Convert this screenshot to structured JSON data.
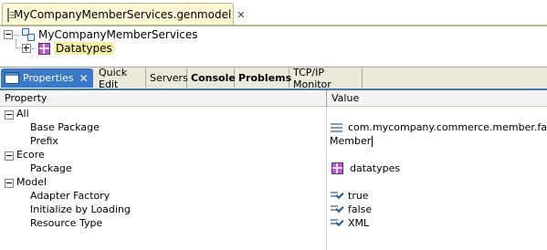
{
  "editor": {
    "tab_title": "MyCompanyMemberServices.genmodel",
    "tree": [
      {
        "label": "MyCompanyMemberServices"
      },
      {
        "label": "Datatypes"
      }
    ]
  },
  "view": {
    "tabs": [
      {
        "label": "Properties"
      },
      {
        "label": "Quick Edit"
      },
      {
        "label": "Servers"
      },
      {
        "label": "Console"
      },
      {
        "label": "Problems"
      },
      {
        "label": "TCP/IP Monitor"
      }
    ],
    "columns": {
      "property": "Property",
      "value": "Value"
    }
  },
  "properties": {
    "all": {
      "label": "All",
      "base_package": {
        "name": "Base Package",
        "value": "com.mycompany.commerce.member.facade"
      },
      "prefix": {
        "name": "Prefix",
        "value": "Member"
      }
    },
    "ecore": {
      "label": "Ecore",
      "package": {
        "name": "Package",
        "value": "datatypes"
      }
    },
    "model": {
      "label": "Model",
      "adapter_factory": {
        "name": "Adapter Factory",
        "value": "true"
      },
      "initialize_by_loading": {
        "name": "Initialize by Loading",
        "value": "false"
      },
      "resource_type": {
        "name": "Resource Type",
        "value": "XML"
      }
    }
  }
}
